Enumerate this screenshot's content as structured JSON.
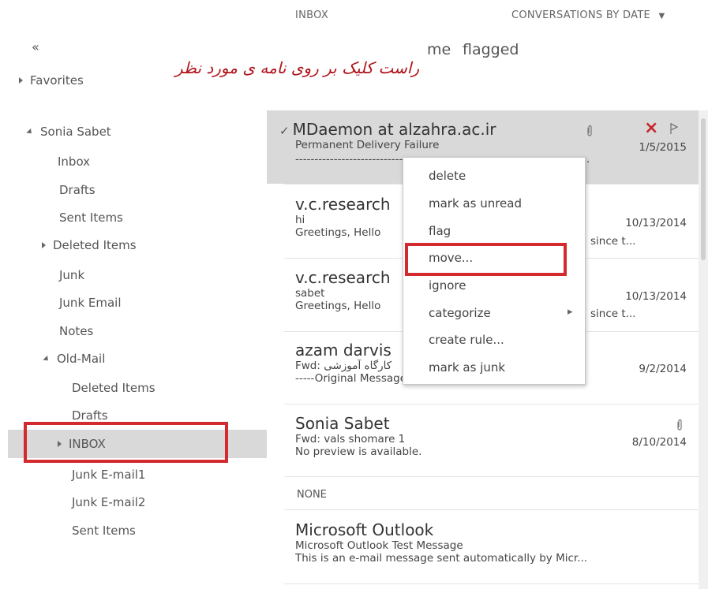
{
  "nav": {
    "collapse_glyph": "«",
    "favorites": "Favorites",
    "account": "Sonia Sabet",
    "items": [
      {
        "label": "Inbox"
      },
      {
        "label": "Drafts"
      },
      {
        "label": "Sent Items"
      },
      {
        "label": "Deleted Items"
      },
      {
        "label": "Junk"
      },
      {
        "label": "Junk Email"
      },
      {
        "label": "Notes"
      },
      {
        "label": "Old-Mail"
      }
    ],
    "old_mail_items": [
      {
        "label": "Deleted Items"
      },
      {
        "label": "Drafts"
      },
      {
        "label": "INBOX"
      },
      {
        "label": "Junk E-mail1"
      },
      {
        "label": "Junk E-mail2"
      },
      {
        "label": "Sent Items"
      }
    ]
  },
  "annotation": {
    "text": "راست کلیک بر روی نامه ی مورد نظر",
    "color": "#d32a2f"
  },
  "header": {
    "folder": "INBOX",
    "sort": "CONVERSATIONS BY DATE",
    "filter_partial": "me",
    "filter_flagged": "flagged"
  },
  "messages": [
    {
      "sender": "MDaemon at alzahra.ac.ir",
      "subject": "Permanent Delivery Failure",
      "preview": "--------------------------------------------------------------------------...",
      "date": "1/5/2015"
    },
    {
      "sender": "v.c.research",
      "subject": "hi",
      "preview": "Greetings,  Hello",
      "preview_tail": "since t...",
      "date": "10/13/2014"
    },
    {
      "sender": "v.c.research",
      "subject": "sabet",
      "preview": "Greetings,  Hello",
      "preview_tail": "since t...",
      "date": "10/13/2014"
    },
    {
      "sender": "azam darvis",
      "subject": "Fwd: کارگاه آموزشی",
      "preview": "-----Original Message----- From: Mahdi Faghih <nrt..",
      "date": "9/2/2014"
    },
    {
      "sender": "Sonia Sabet",
      "subject": "Fwd: vals shomare 1",
      "preview": "No preview is available.",
      "date": "8/10/2014"
    }
  ],
  "group_none": "NONE",
  "message_last": {
    "sender": "Microsoft Outlook",
    "subject": "Microsoft Outlook Test Message",
    "preview": "This is an e-mail message sent automatically by Micr..."
  },
  "context_menu": [
    {
      "label": "delete"
    },
    {
      "label": "mark as unread"
    },
    {
      "label": "flag"
    },
    {
      "label": "move..."
    },
    {
      "label": "ignore"
    },
    {
      "label": "categorize"
    },
    {
      "label": "create rule..."
    },
    {
      "label": "mark as junk"
    }
  ],
  "icons": {
    "check": "✓",
    "attach": "paperclip-icon",
    "delete": "×",
    "flag": "flag-icon",
    "submenu": "▸"
  },
  "colors": {
    "highlight": "#d32a2f",
    "selected_bg": "#d9d9d9"
  }
}
